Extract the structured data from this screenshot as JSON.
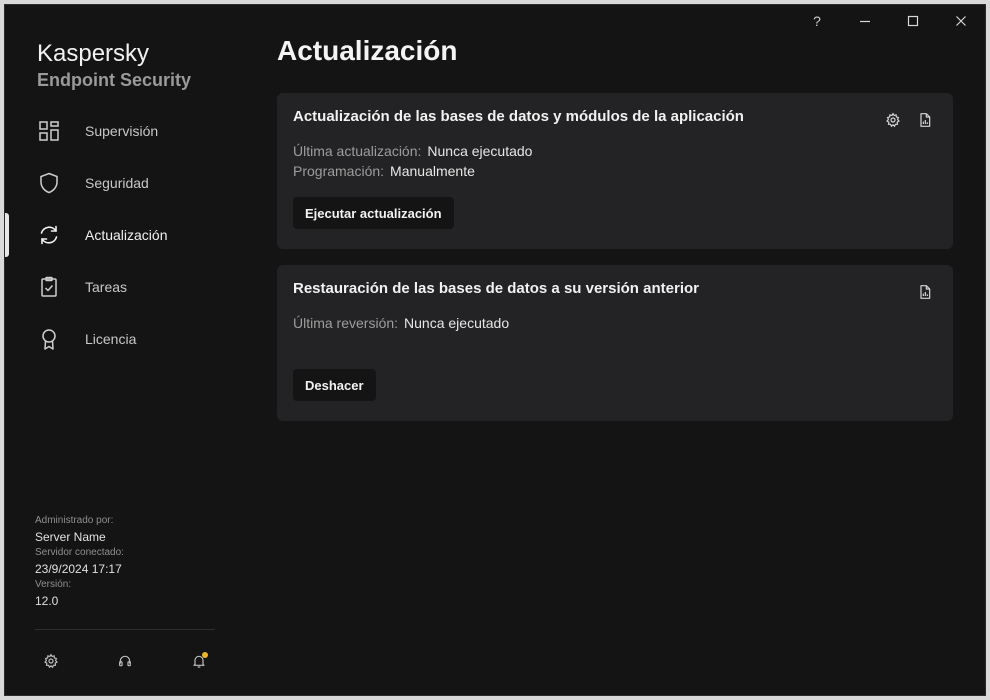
{
  "window": {
    "help_label": "?"
  },
  "brand": {
    "name": "Kaspersky",
    "product": "Endpoint Security"
  },
  "nav": {
    "items": [
      {
        "label": "Supervisión",
        "icon": "dashboard-icon"
      },
      {
        "label": "Seguridad",
        "icon": "shield-icon"
      },
      {
        "label": "Actualización",
        "icon": "refresh-icon",
        "active": true
      },
      {
        "label": "Tareas",
        "icon": "clipboard-icon"
      },
      {
        "label": "Licencia",
        "icon": "award-icon"
      }
    ]
  },
  "info": {
    "managed_label": "Administrado por:",
    "managed_value": "Server Name",
    "server_label": "Servidor conectado:",
    "server_value": "23/9/2024 17:17",
    "version_label": "Versión:",
    "version_value": "12.0"
  },
  "page": {
    "title": "Actualización"
  },
  "cards": {
    "update": {
      "title": "Actualización de las bases de datos y módulos de la aplicación",
      "last_label": "Última actualización:",
      "last_value": "Nunca ejecutado",
      "schedule_label": "Programación:",
      "schedule_value": "Manualmente",
      "button_label": "Ejecutar actualización"
    },
    "rollback": {
      "title": "Restauración de las bases de datos a su versión anterior",
      "last_label": "Última reversión:",
      "last_value": "Nunca ejecutado",
      "button_label": "Deshacer"
    }
  },
  "colors": {
    "background": "#141414",
    "card": "#232325",
    "notification": "#f0b429"
  }
}
